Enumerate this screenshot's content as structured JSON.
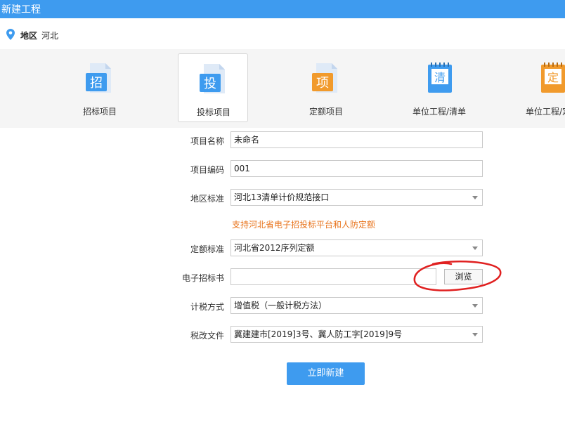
{
  "window": {
    "title": "新建工程"
  },
  "region": {
    "label": "地区",
    "value": "河北"
  },
  "project_types": [
    {
      "label": "招标项目",
      "icon_char": "招",
      "icon_color": "#3e9bef"
    },
    {
      "label": "投标项目",
      "icon_char": "投",
      "icon_color": "#3e9bef"
    },
    {
      "label": "定额项目",
      "icon_char": "项",
      "icon_color": "#f19a2c"
    },
    {
      "label": "单位工程/清单",
      "icon_char": "清",
      "icon_color": "#3e9bef"
    },
    {
      "label": "单位工程/定额",
      "icon_char": "定",
      "icon_color": "#f19a2c"
    }
  ],
  "selected_type": "投标项目",
  "form": {
    "name": {
      "label": "项目名称",
      "value": "未命名"
    },
    "code": {
      "label": "项目编码",
      "value": "001"
    },
    "area_standard": {
      "label": "地区标准",
      "value": "河北13清单计价规范接口"
    },
    "hint": "支持河北省电子招投标平台和人防定额",
    "quota_standard": {
      "label": "定额标准",
      "value": "河北省2012序列定额"
    },
    "bid_file": {
      "label": "电子招标书",
      "value": "",
      "browse_label": "浏览"
    },
    "tax_method": {
      "label": "计税方式",
      "value": "增值税（一般计税方法）"
    },
    "tax_reform": {
      "label": "税改文件",
      "value": "冀建建市[2019]3号、冀人防工字[2019]9号"
    }
  },
  "create_button": "立即新建",
  "colors": {
    "accent": "#3e9bef",
    "hint": "#e8731b",
    "annotation": "#e02020"
  }
}
